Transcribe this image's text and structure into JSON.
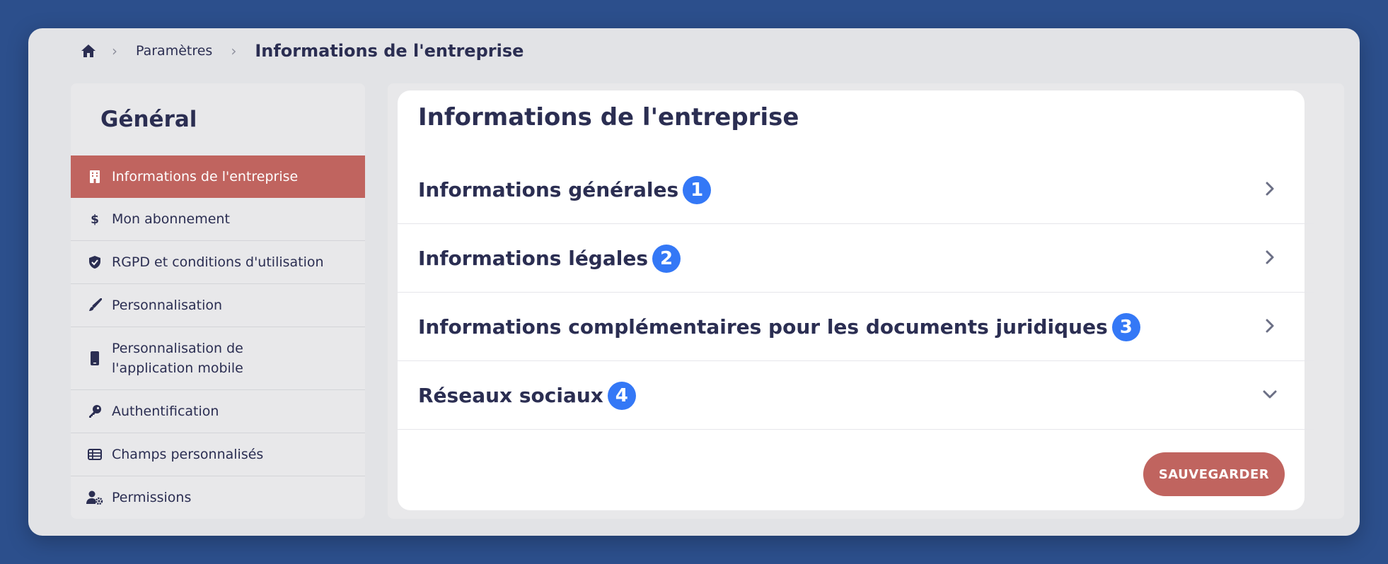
{
  "breadcrumb": {
    "home_icon": "home-icon",
    "parent": "Paramètres",
    "current": "Informations de l'entreprise"
  },
  "sidebar": {
    "title": "Général",
    "items": [
      {
        "label": "Informations de l'entreprise",
        "icon": "building-icon",
        "active": true
      },
      {
        "label": "Mon abonnement",
        "icon": "dollar-icon"
      },
      {
        "label": "RGPD et conditions d'utilisation",
        "icon": "shield-check-icon"
      },
      {
        "label": "Personnalisation",
        "icon": "paintbrush-icon"
      },
      {
        "label": "Personnalisation de l'application mobile",
        "icon": "mobile-icon"
      },
      {
        "label": "Authentification",
        "icon": "key-icon"
      },
      {
        "label": "Champs personnalisés",
        "icon": "table-list-icon"
      },
      {
        "label": "Permissions",
        "icon": "user-gear-icon"
      }
    ]
  },
  "main": {
    "title": "Informations de l'entreprise",
    "sections": [
      {
        "label": "Informations générales",
        "badge": "1",
        "state": "collapsed"
      },
      {
        "label": "Informations légales",
        "badge": "2",
        "state": "collapsed"
      },
      {
        "label": "Informations complémentaires pour les documents juridiques",
        "badge": "3",
        "state": "collapsed"
      },
      {
        "label": "Réseaux sociaux",
        "badge": "4",
        "state": "expanded"
      }
    ],
    "save_label": "SAUVEGARDER"
  },
  "colors": {
    "background": "#2c4f8c",
    "accent": "#c0645f",
    "badge": "#3478f6",
    "text": "#2b2e52"
  }
}
